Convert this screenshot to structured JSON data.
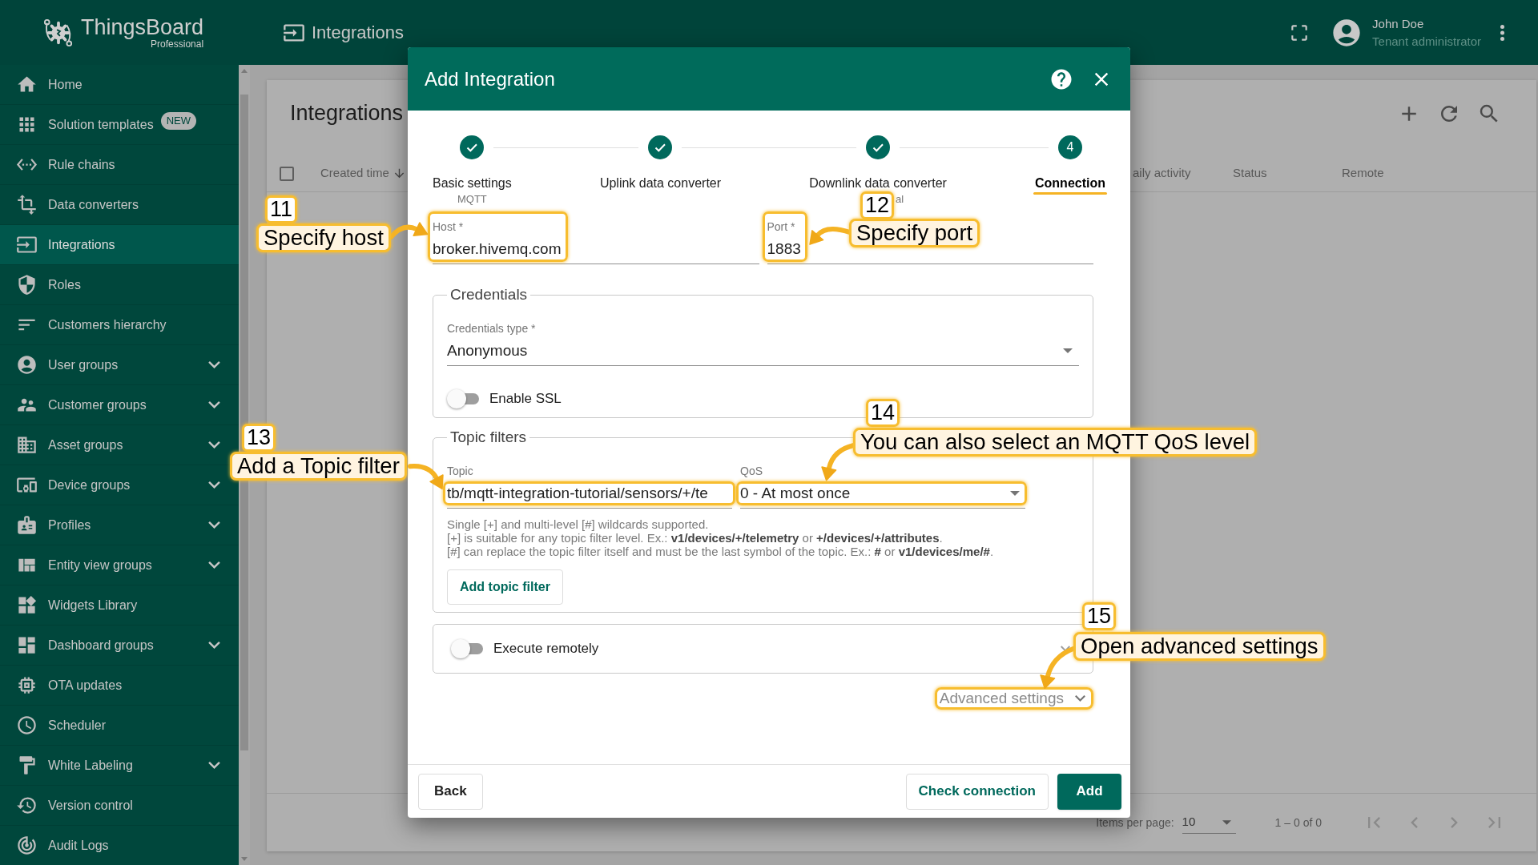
{
  "brand": {
    "name": "ThingsBoard",
    "edition": "Professional"
  },
  "top_bar": {
    "title": "Integrations",
    "user": {
      "name": "John Doe",
      "role": "Tenant administrator"
    }
  },
  "sidebar": {
    "items": [
      {
        "label": "Home",
        "kind": "link",
        "selected": false
      },
      {
        "label": "Solution templates",
        "kind": "link",
        "badge": "NEW",
        "selected": false
      },
      {
        "label": "Rule chains",
        "kind": "link",
        "selected": false
      },
      {
        "label": "Data converters",
        "kind": "link",
        "selected": false
      },
      {
        "label": "Integrations",
        "kind": "link",
        "selected": true
      },
      {
        "label": "Roles",
        "kind": "link",
        "selected": false
      },
      {
        "label": "Customers hierarchy",
        "kind": "link",
        "selected": false
      },
      {
        "label": "User groups",
        "kind": "group",
        "expanded": false,
        "selected": false
      },
      {
        "label": "Customer groups",
        "kind": "group",
        "expanded": false,
        "selected": false
      },
      {
        "label": "Asset groups",
        "kind": "group",
        "expanded": false,
        "selected": false
      },
      {
        "label": "Device groups",
        "kind": "group",
        "expanded": false,
        "selected": false
      },
      {
        "label": "Profiles",
        "kind": "group",
        "expanded": false,
        "selected": false
      },
      {
        "label": "Entity view groups",
        "kind": "group",
        "expanded": false,
        "selected": false
      },
      {
        "label": "Widgets Library",
        "kind": "link",
        "selected": false
      },
      {
        "label": "Dashboard groups",
        "kind": "group",
        "expanded": false,
        "selected": false
      },
      {
        "label": "OTA updates",
        "kind": "link",
        "selected": false
      },
      {
        "label": "Scheduler",
        "kind": "link",
        "selected": false
      },
      {
        "label": "White Labeling",
        "kind": "group",
        "expanded": false,
        "selected": false
      },
      {
        "label": "Version control",
        "kind": "link",
        "selected": false
      },
      {
        "label": "Audit Logs",
        "kind": "link",
        "selected": false
      }
    ]
  },
  "page": {
    "title": "Integrations",
    "table": {
      "select_all": {
        "checked": false
      },
      "columns": [
        {
          "label": "Created time",
          "sorted": true
        },
        {
          "label": "aily activity",
          "sorted": false
        },
        {
          "label": "Status",
          "sorted": false
        },
        {
          "label": "Remote",
          "sorted": false
        }
      ]
    },
    "paginator": {
      "label": "Items per page:",
      "page_size": "10",
      "range": "1 – 0 of 0"
    }
  },
  "dialog": {
    "title": "Add Integration",
    "steps": [
      {
        "label": "Basic settings",
        "sublabel": "MQTT",
        "completed": true,
        "selected": false,
        "highlighted": false
      },
      {
        "label": "Uplink data converter",
        "completed": true,
        "selected": false,
        "highlighted": false
      },
      {
        "label": "Downlink data converter",
        "sublabel": "al",
        "completed": true,
        "selected": false,
        "highlighted": false
      },
      {
        "label": "Connection",
        "number": "4",
        "completed": false,
        "selected": true,
        "highlighted": true
      }
    ],
    "host": {
      "label": "Host *",
      "value": "broker.hivemq.com",
      "highlighted": true
    },
    "port": {
      "label": "Port *",
      "value": "1883",
      "highlighted": true
    },
    "credentials": {
      "legend": "Credentials",
      "type_label": "Credentials type *",
      "type_value": "Anonymous",
      "ssl_label": "Enable SSL",
      "ssl_on": false
    },
    "topic_filters": {
      "legend": "Topic filters",
      "filters": [
        {
          "topic_label": "Topic",
          "topic": "tb/mqtt-integration-tutorial/sensors/+/te",
          "topic_highlighted": true,
          "qos_label": "QoS",
          "qos": "0 - At most once",
          "qos_highlighted": true
        }
      ],
      "hints": [
        "Single [+] and multi-level [#] wildcards supported.",
        "[+] is suitable for any topic filter level. Ex.: **v1/devices/+/telemetry** or **+/devices/+/attributes**.",
        "[#] can replace the topic filter itself and must be the last symbol of the topic. Ex.: **#** or **v1/devices/me/#**."
      ],
      "add_button": "Add topic filter"
    },
    "execute_remotely": {
      "label": "Execute remotely",
      "on": false,
      "expanded": false
    },
    "advanced_settings": {
      "label": "Advanced settings",
      "expanded": false,
      "highlighted": true
    },
    "buttons": {
      "back": "Back",
      "check": "Check connection",
      "add": "Add"
    }
  },
  "callouts": [
    {
      "number": "11",
      "text": "Specify host"
    },
    {
      "number": "12",
      "text": "Specify port"
    },
    {
      "number": "13",
      "text": "Add a Topic filter"
    },
    {
      "number": "14",
      "text": "You can also select an MQTT QoS level"
    },
    {
      "number": "15",
      "text": "Open advanced settings"
    }
  ]
}
